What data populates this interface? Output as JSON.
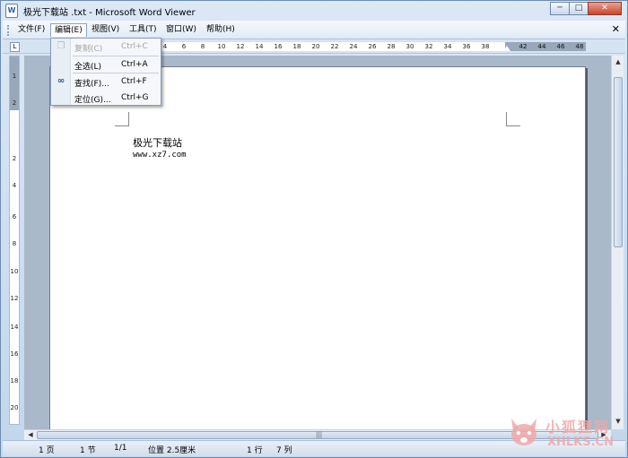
{
  "window": {
    "title": "极光下载站  .txt - Microsoft Word Viewer",
    "icon": "word-viewer-icon",
    "minimize": "─",
    "maximize": "□",
    "close": "✕"
  },
  "menubar": {
    "items": [
      "文件(F)",
      "编辑(E)",
      "视图(V)",
      "工具(T)",
      "窗口(W)",
      "帮助(H)"
    ],
    "active": "编辑(E)",
    "doc_close": "✕"
  },
  "edit_menu": {
    "items": [
      {
        "label": "复制(C)",
        "shortcut": "Ctrl+C",
        "enabled": false,
        "icon": "copy-icon"
      },
      {
        "label": "全选(L)",
        "shortcut": "Ctrl+A",
        "enabled": true,
        "icon": ""
      },
      {
        "label": "查找(F)...",
        "shortcut": "Ctrl+F",
        "enabled": true,
        "icon": "find-icon"
      },
      {
        "label": "定位(G)...",
        "shortcut": "Ctrl+G",
        "enabled": true,
        "icon": ""
      }
    ]
  },
  "ruler": {
    "corner": "L",
    "numbers": [
      "4",
      "6",
      "8",
      "10",
      "12",
      "14",
      "16",
      "18",
      "20",
      "22",
      "24",
      "26",
      "28",
      "30",
      "32",
      "34",
      "36",
      "38",
      "42",
      "44",
      "46",
      "48"
    ]
  },
  "vruler": {
    "numbers": [
      "1",
      "2",
      "2",
      "4",
      "6",
      "8",
      "10",
      "12",
      "14",
      "16",
      "18",
      "20"
    ]
  },
  "document": {
    "line1": "极光下载站",
    "line2": "www.xz7.com"
  },
  "statusbar": {
    "page": "1 页",
    "section": "1 节",
    "page_of": "1/1",
    "position": "位置 2.5厘米",
    "line": "1 行",
    "column": "7 列"
  },
  "watermark": {
    "cn": "小狐狸网",
    "en": "XHLKS.CN"
  },
  "colors": {
    "accent": "#6d8bb0",
    "watermark": "#f0a8a8"
  }
}
